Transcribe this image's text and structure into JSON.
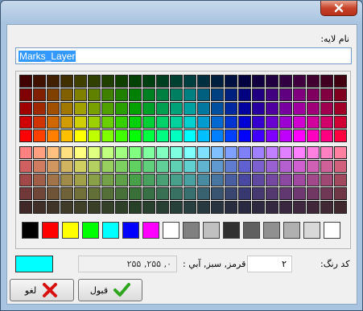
{
  "dialog": {
    "layer_name_label": "نام لايه:",
    "layer_name_value": "Marks_Layer"
  },
  "palette": {
    "rows": [
      [
        "#400000",
        "#401000",
        "#402000",
        "#403000",
        "#404000",
        "#304000",
        "#204000",
        "#104000",
        "#004000",
        "#004010",
        "#004020",
        "#004030",
        "#004040",
        "#003040",
        "#002040",
        "#001040",
        "#000040",
        "#100040",
        "#200040",
        "#300040",
        "#400040",
        "#400030",
        "#400020",
        "#400010"
      ],
      [
        "#800000",
        "#802000",
        "#804000",
        "#806000",
        "#808000",
        "#608000",
        "#408000",
        "#208000",
        "#008000",
        "#008020",
        "#008040",
        "#008060",
        "#008080",
        "#006080",
        "#004080",
        "#002080",
        "#000080",
        "#200080",
        "#400080",
        "#600080",
        "#800080",
        "#800060",
        "#800040",
        "#800020"
      ],
      [
        "#a00000",
        "#a02800",
        "#a05000",
        "#a07800",
        "#a0a000",
        "#78a000",
        "#50a000",
        "#28a000",
        "#00a000",
        "#00a028",
        "#00a050",
        "#00a078",
        "#00a0a0",
        "#0078a0",
        "#0050a0",
        "#0028a0",
        "#0000a0",
        "#2800a0",
        "#5000a0",
        "#7800a0",
        "#a000a0",
        "#a00078",
        "#a00050",
        "#a00028"
      ],
      [
        "#d00000",
        "#d03400",
        "#d06800",
        "#d09c00",
        "#d0d000",
        "#9cd000",
        "#68d000",
        "#34d000",
        "#00d000",
        "#00d034",
        "#00d068",
        "#00d09c",
        "#00d0d0",
        "#009cd0",
        "#0068d0",
        "#0034d0",
        "#0000d0",
        "#3400d0",
        "#6800d0",
        "#9c00d0",
        "#d000d0",
        "#d0009c",
        "#d00068",
        "#d00034"
      ],
      [
        "#ff0000",
        "#ff4000",
        "#ff8000",
        "#ffc000",
        "#ffff00",
        "#c0ff00",
        "#80ff00",
        "#40ff00",
        "#00ff00",
        "#00ff40",
        "#00ff80",
        "#00ffc0",
        "#00ffff",
        "#00c0ff",
        "#0080ff",
        "#0040ff",
        "#0000ff",
        "#4000ff",
        "#8000ff",
        "#c000ff",
        "#ff00ff",
        "#ff00c0",
        "#ff0080",
        "#ff0040"
      ],
      [
        "#ff8080",
        "#ffa080",
        "#ffc080",
        "#ffe080",
        "#ffff80",
        "#e0ff80",
        "#c0ff80",
        "#a0ff80",
        "#80ff80",
        "#80ffa0",
        "#80ffc0",
        "#80ffe0",
        "#80ffff",
        "#80e0ff",
        "#80c0ff",
        "#80a0ff",
        "#8080ff",
        "#a080ff",
        "#c080ff",
        "#e080ff",
        "#ff80ff",
        "#ff80e0",
        "#ff80c0",
        "#ff80a0"
      ],
      [
        "#d06060",
        "#d07c60",
        "#d09860",
        "#d0b460",
        "#d0d060",
        "#b4d060",
        "#98d060",
        "#7cd060",
        "#60d060",
        "#60d07c",
        "#60d098",
        "#60d0b4",
        "#60d0d0",
        "#60b4d0",
        "#6098d0",
        "#607cd0",
        "#6060d0",
        "#7c60d0",
        "#9860d0",
        "#b460d0",
        "#d060d0",
        "#d060b4",
        "#d06098",
        "#d0607c"
      ],
      [
        "#a04848",
        "#a05e48",
        "#a07448",
        "#a08a48",
        "#a0a048",
        "#8aa048",
        "#74a048",
        "#5ea048",
        "#48a048",
        "#48a05e",
        "#48a074",
        "#48a08a",
        "#48a0a0",
        "#488aa0",
        "#4874a0",
        "#485ea0",
        "#4848a0",
        "#5e48a0",
        "#7448a0",
        "#8a48a0",
        "#a048a0",
        "#a0488a",
        "#a04874",
        "#a0485e"
      ],
      [
        "#703838",
        "#704638",
        "#705438",
        "#706238",
        "#707038",
        "#627038",
        "#547038",
        "#467038",
        "#387038",
        "#387046",
        "#387054",
        "#387062",
        "#387070",
        "#386270",
        "#385470",
        "#384670",
        "#383870",
        "#463870",
        "#543870",
        "#623870",
        "#703870",
        "#703862",
        "#703854",
        "#703846"
      ],
      [
        "#402828",
        "#402e28",
        "#403428",
        "#403a28",
        "#404028",
        "#3a4028",
        "#344028",
        "#2e4028",
        "#284028",
        "#28402e",
        "#284034",
        "#28403a",
        "#284040",
        "#283a40",
        "#283440",
        "#282e40",
        "#282840",
        "#2e2840",
        "#342840",
        "#3a2840",
        "#402840",
        "#40283a",
        "#402834",
        "#40282e"
      ]
    ],
    "basic_colors": [
      "#000000",
      "#ff0000",
      "#ffff00",
      "#00ff00",
      "#00ffff",
      "#0000ff",
      "#ff00ff",
      "#ffffff",
      "#808080",
      "#c0c0c0",
      "#303030",
      "#606060",
      "#909090",
      "#b0b0b0",
      "#d8d8d8",
      "#ffffff"
    ]
  },
  "selection": {
    "preview_color": "#00ffff",
    "rgb_value": "۰, ۲۵۵, ۲۵۵",
    "rgb_label": "قرمز, سبز, آبي :",
    "code_value": "۲",
    "code_label": "کد رنگ:"
  },
  "buttons": {
    "cancel_label": "لغو",
    "ok_label": "قبول"
  }
}
